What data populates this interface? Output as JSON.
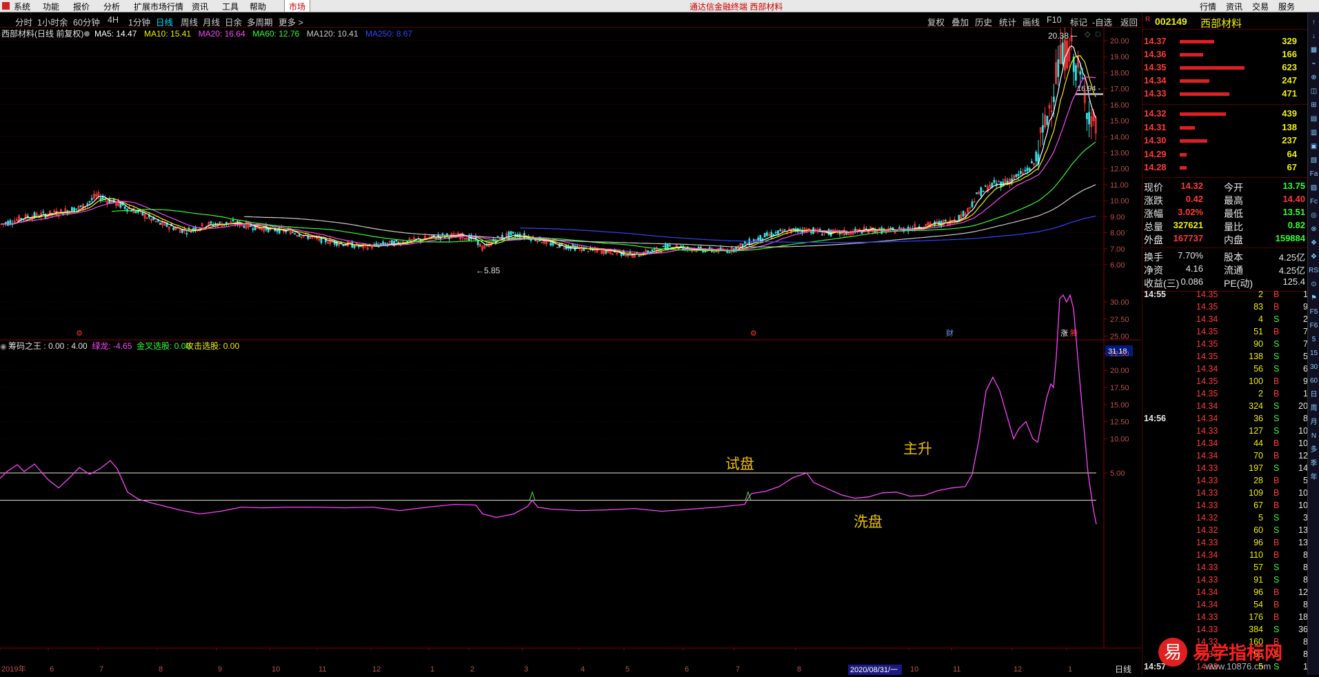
{
  "menubar": {
    "items": [
      "系统",
      "功能",
      "报价",
      "分析",
      "扩展市场行情",
      "资讯",
      "工具",
      "帮助"
    ],
    "market_tab": "市场",
    "title": "通达信金融终端 西部材料",
    "right_items": [
      "行情",
      "资讯",
      "交易",
      "服务"
    ]
  },
  "toolbar": {
    "periods": [
      "分时",
      "1小时余",
      "60分钟",
      "4H",
      "1分钟",
      "日线",
      "周线",
      "月线",
      "日余",
      "多周期",
      "更多"
    ],
    "active": "日线",
    "right": [
      "复权",
      "叠加",
      "历史",
      "统计",
      "画线",
      "F10",
      "标记",
      "-自选",
      "返回"
    ]
  },
  "main_panel": {
    "title": "西部材料(日线 前复权)",
    "ma_legend": [
      {
        "text": "MA5: 14.47",
        "color": "#ffffff"
      },
      {
        "text": "MA10: 15.41",
        "color": "#f0f000"
      },
      {
        "text": "MA20: 16.64",
        "color": "#ff44ff"
      },
      {
        "text": "MA60: 12.76",
        "color": "#33ff33"
      },
      {
        "text": "MA120: 10.41",
        "color": "#cccccc"
      },
      {
        "text": "MA250: 8.67",
        "color": "#3344ff"
      }
    ],
    "y_ticks": [
      "20.00",
      "19.00",
      "18.00",
      "17.00",
      "16.00",
      "15.00",
      "14.00",
      "13.00",
      "12.00",
      "11.00",
      "10.00",
      "9.00",
      "8.00",
      "7.00",
      "6.00"
    ],
    "high_label": "20.38",
    "low_label": "5.85",
    "crosshair_label": "16.94",
    "markers": [
      {
        "text": "⚙",
        "color": "#ff3333",
        "x": 110
      },
      {
        "text": "⚙",
        "color": "#ff3333",
        "x": 1088
      },
      {
        "text": "财",
        "color": "#6699ff",
        "x": 1372
      },
      {
        "text": "涨",
        "color": "#ffffff",
        "x": 1538
      },
      {
        "text": "腾",
        "color": "#ff3333",
        "x": 1552
      }
    ]
  },
  "sub_panel": {
    "indicator_legend": [
      {
        "text": "筹码之王 : 0.00 : 4.00",
        "color": "#e0e0e0"
      },
      {
        "text": "绿龙: -4.65",
        "color": "#ff44ff"
      },
      {
        "text": "金叉选股: 0.00",
        "color": "#33ff33"
      },
      {
        "text": "攻击选股: 0.00",
        "color": "#f0f000"
      }
    ],
    "top_value": "31.18",
    "y_ticks": [
      "30.00",
      "27.50",
      "25.00",
      "22.50",
      "20.00",
      "17.50",
      "15.00",
      "12.50",
      "10.00",
      "5.00"
    ],
    "annotations": [
      {
        "text": "试盘",
        "color": "#f0c000"
      },
      {
        "text": "主升",
        "color": "#f0c000"
      },
      {
        "text": "洗盘",
        "color": "#f0c000"
      }
    ],
    "x_labels": [
      "2019年",
      "6",
      "7",
      "8",
      "9",
      "10",
      "11",
      "12",
      "1",
      "2",
      "3",
      "4",
      "5",
      "6",
      "7",
      "8",
      "10",
      "11",
      "12",
      "1"
    ],
    "date_badge": "2020/08/31/一",
    "period_label": "日线"
  },
  "quote": {
    "code": "002149",
    "name": "西部材料",
    "asks": [
      {
        "price": "14.37",
        "vol": "329",
        "bar": 0.42
      },
      {
        "price": "14.36",
        "vol": "166",
        "bar": 0.28
      },
      {
        "price": "14.35",
        "vol": "623",
        "bar": 0.78
      },
      {
        "price": "14.34",
        "vol": "247",
        "bar": 0.36
      },
      {
        "price": "14.33",
        "vol": "471",
        "bar": 0.6
      }
    ],
    "bids": [
      {
        "price": "14.32",
        "vol": "439",
        "bar": 0.56
      },
      {
        "price": "14.31",
        "vol": "138",
        "bar": 0.18
      },
      {
        "price": "14.30",
        "vol": "237",
        "bar": 0.33
      },
      {
        "price": "14.29",
        "vol": "64",
        "bar": 0.08
      },
      {
        "price": "14.28",
        "vol": "67",
        "bar": 0.08
      }
    ],
    "stats": [
      {
        "l1": "现价",
        "v1": "14.32",
        "c1": "red",
        "l2": "今开",
        "v2": "13.75",
        "c2": "green"
      },
      {
        "l1": "涨跌",
        "v1": "0.42",
        "c1": "red",
        "l2": "最高",
        "v2": "14.40",
        "c2": "red"
      },
      {
        "l1": "涨幅",
        "v1": "3.02%",
        "c1": "red",
        "l2": "最低",
        "v2": "13.51",
        "c2": "green"
      },
      {
        "l1": "总量",
        "v1": "327621",
        "c1": "yellow",
        "l2": "量比",
        "v2": "0.82",
        "c2": "green"
      },
      {
        "l1": "外盘",
        "v1": "167737",
        "c1": "red",
        "l2": "内盘",
        "v2": "159884",
        "c2": "green"
      }
    ],
    "stats2": [
      {
        "l1": "换手",
        "v1": "7.70%",
        "c1": "white",
        "l2": "股本",
        "v2": "4.25亿",
        "c2": "white"
      },
      {
        "l1": "净资",
        "v1": "4.16",
        "c1": "white",
        "l2": "流通",
        "v2": "4.25亿",
        "c2": "white"
      },
      {
        "l1": "收益(三)",
        "v1": "0.086",
        "c1": "white",
        "l2": "PE(动)",
        "v2": "125.4",
        "c2": "white"
      }
    ],
    "ticks": [
      {
        "t": "14:55",
        "p": "14.35",
        "c": "red",
        "v": "2",
        "s": "B",
        "n": "1"
      },
      {
        "t": "",
        "p": "14.35",
        "c": "red",
        "v": "83",
        "s": "B",
        "n": "9"
      },
      {
        "t": "",
        "p": "14.34",
        "c": "red",
        "v": "4",
        "s": "S",
        "n": "2"
      },
      {
        "t": "",
        "p": "14.35",
        "c": "red",
        "v": "51",
        "s": "B",
        "n": "7"
      },
      {
        "t": "",
        "p": "14.35",
        "c": "red",
        "v": "90",
        "s": "S",
        "n": "7"
      },
      {
        "t": "",
        "p": "14.35",
        "c": "red",
        "v": "138",
        "s": "S",
        "n": "5"
      },
      {
        "t": "",
        "p": "14.34",
        "c": "red",
        "v": "56",
        "s": "S",
        "n": "6"
      },
      {
        "t": "",
        "p": "14.35",
        "c": "red",
        "v": "100",
        "s": "B",
        "n": "9"
      },
      {
        "t": "",
        "p": "14.35",
        "c": "red",
        "v": "2",
        "s": "B",
        "n": "1"
      },
      {
        "t": "",
        "p": "14.34",
        "c": "red",
        "v": "324",
        "s": "S",
        "n": "20"
      },
      {
        "t": "14:56",
        "p": "14.34",
        "c": "red",
        "v": "36",
        "s": "S",
        "n": "8"
      },
      {
        "t": "",
        "p": "14.33",
        "c": "red",
        "v": "127",
        "s": "S",
        "n": "10"
      },
      {
        "t": "",
        "p": "14.34",
        "c": "red",
        "v": "44",
        "s": "B",
        "n": "10"
      },
      {
        "t": "",
        "p": "14.34",
        "c": "red",
        "v": "70",
        "s": "B",
        "n": "12"
      },
      {
        "t": "",
        "p": "14.33",
        "c": "red",
        "v": "197",
        "s": "S",
        "n": "14"
      },
      {
        "t": "",
        "p": "14.33",
        "c": "red",
        "v": "28",
        "s": "B",
        "n": "5"
      },
      {
        "t": "",
        "p": "14.33",
        "c": "red",
        "v": "109",
        "s": "B",
        "n": "10"
      },
      {
        "t": "",
        "p": "14.33",
        "c": "red",
        "v": "67",
        "s": "B",
        "n": "10"
      },
      {
        "t": "",
        "p": "14.32",
        "c": "red",
        "v": "5",
        "s": "S",
        "n": "3"
      },
      {
        "t": "",
        "p": "14.32",
        "c": "red",
        "v": "60",
        "s": "S",
        "n": "13"
      },
      {
        "t": "",
        "p": "14.33",
        "c": "red",
        "v": "96",
        "s": "B",
        "n": "13"
      },
      {
        "t": "",
        "p": "14.34",
        "c": "red",
        "v": "110",
        "s": "B",
        "n": "8"
      },
      {
        "t": "",
        "p": "14.33",
        "c": "red",
        "v": "57",
        "s": "S",
        "n": "8"
      },
      {
        "t": "",
        "p": "14.33",
        "c": "red",
        "v": "91",
        "s": "S",
        "n": "8"
      },
      {
        "t": "",
        "p": "14.34",
        "c": "red",
        "v": "96",
        "s": "B",
        "n": "12"
      },
      {
        "t": "",
        "p": "14.34",
        "c": "red",
        "v": "54",
        "s": "B",
        "n": "8"
      },
      {
        "t": "",
        "p": "14.33",
        "c": "red",
        "v": "176",
        "s": "B",
        "n": "18"
      },
      {
        "t": "",
        "p": "14.33",
        "c": "red",
        "v": "384",
        "s": "S",
        "n": "36"
      },
      {
        "t": "",
        "p": "14.33",
        "c": "red",
        "v": "160",
        "s": "B",
        "n": "8"
      },
      {
        "t": "",
        "p": "14.33",
        "c": "red",
        "v": "55",
        "s": "S",
        "n": "8"
      },
      {
        "t": "14:57",
        "p": "14.33",
        "c": "red",
        "v": "5",
        "s": "S",
        "n": "1"
      }
    ]
  },
  "side_icons": [
    "↑",
    "↓",
    "▦",
    "⌁",
    "⊕",
    "◫",
    "⊞",
    "▤",
    "▥",
    "▣",
    "▧",
    "Fa",
    "▨",
    "Fc",
    "◎",
    "⊗",
    "❖",
    "✥",
    "RSI",
    "⊙",
    "⚑",
    "F5",
    "F6",
    "5",
    "15",
    "30",
    "60",
    "日",
    "周",
    "月",
    "N",
    "多",
    "季",
    "年"
  ],
  "watermark": {
    "logo": "易",
    "text": "易学指标网",
    "url": "www.10876.com"
  }
}
